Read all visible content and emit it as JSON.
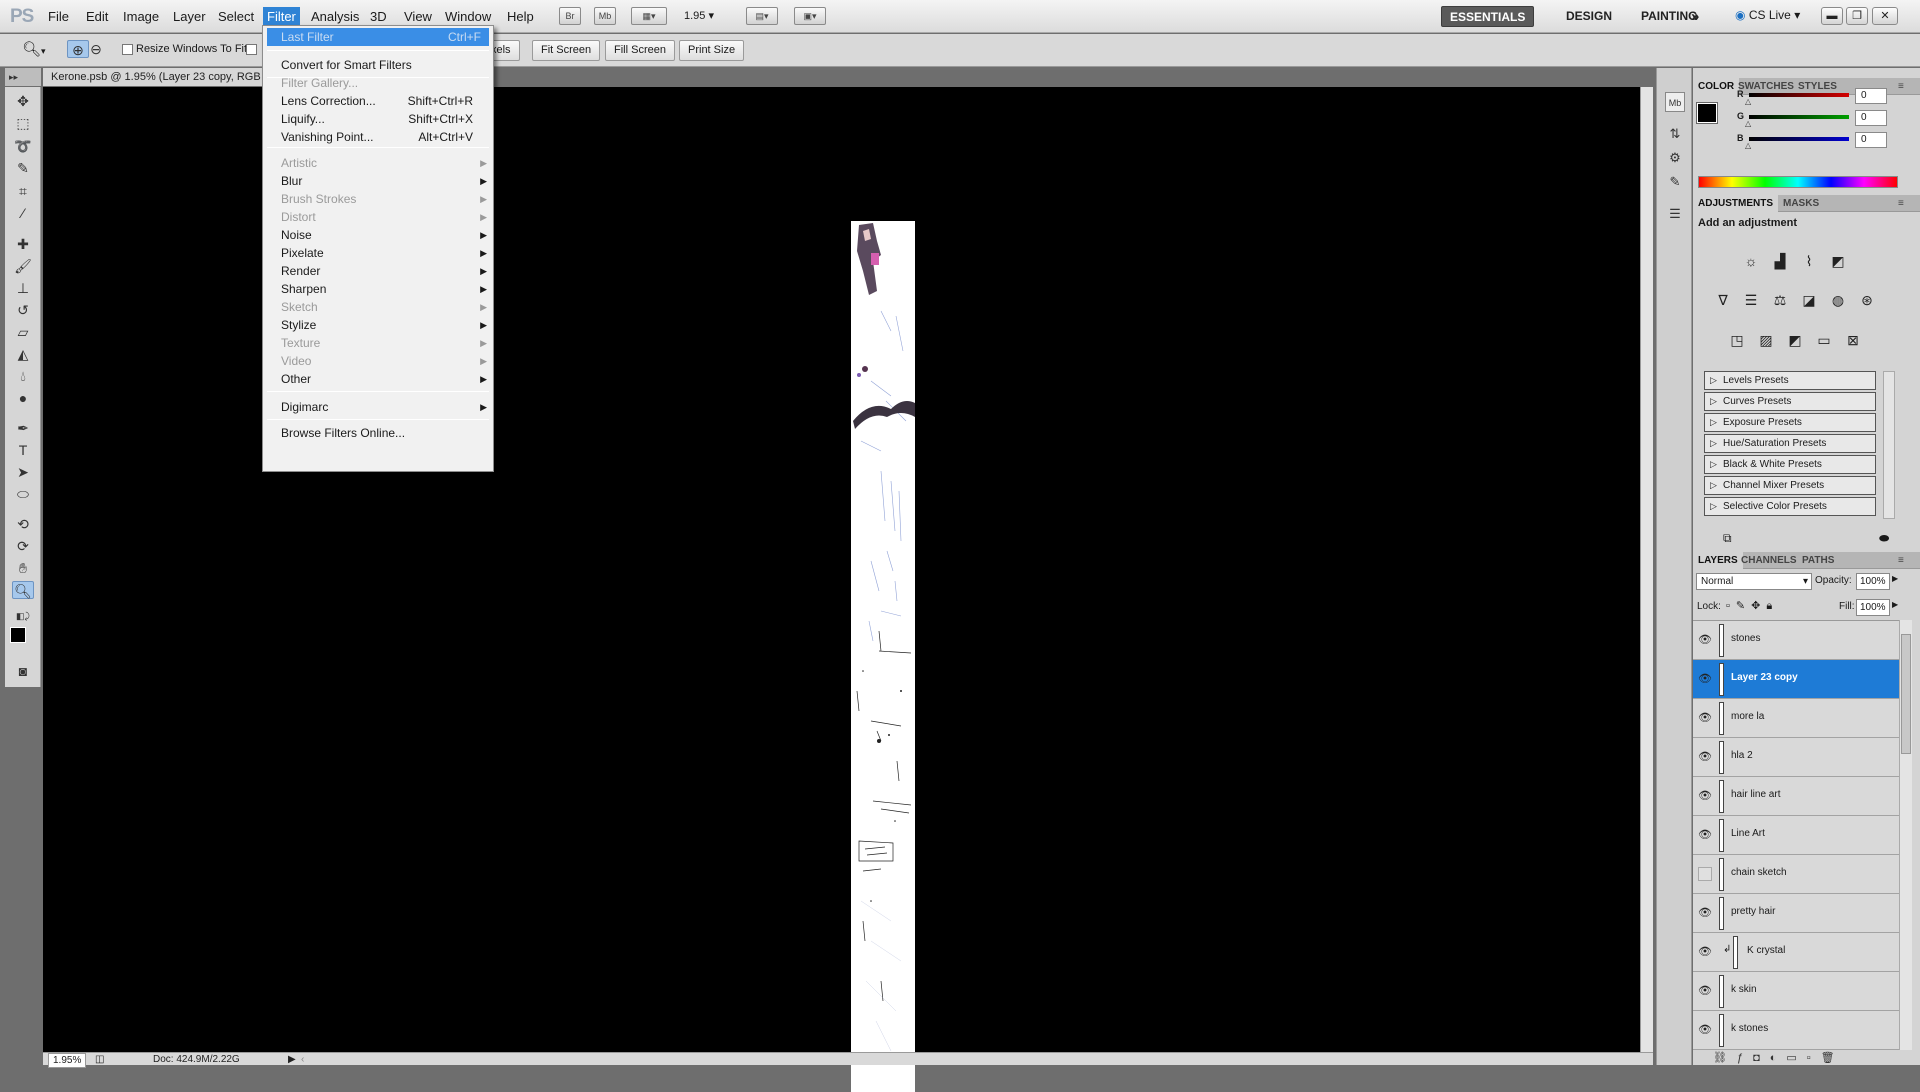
{
  "app": {
    "logo": "PS"
  },
  "menubar": {
    "items": [
      "File",
      "Edit",
      "Image",
      "Layer",
      "Select",
      "Filter",
      "Analysis",
      "3D",
      "View",
      "Window",
      "Help"
    ],
    "active": "Filter",
    "br_label": "Br",
    "mb_label": "Mb",
    "zoom_value": "1.95",
    "workspaces": [
      "ESSENTIALS",
      "DESIGN",
      "PAINTING"
    ],
    "cslive": "CS Live"
  },
  "options": {
    "resize_windows": "Resize Windows To Fit",
    "pixels_partial": "xels",
    "fit_screen": "Fit Screen",
    "fill_screen": "Fill Screen",
    "print_size": "Print Size"
  },
  "document": {
    "tab_title": "Kerone.psb @ 1.95% (Layer 23 copy, RGB",
    "status_zoom": "1.95%",
    "status_doc": "Doc: 424.9M/2.22G"
  },
  "filter_menu": {
    "items": [
      {
        "label": "Last Filter",
        "shortcut": "Ctrl+F",
        "disabled": true,
        "highlighted": true
      },
      {
        "label": "Convert for Smart Filters"
      },
      {
        "label": "Filter Gallery...",
        "disabled": true
      },
      {
        "label": "Lens Correction...",
        "shortcut": "Shift+Ctrl+R"
      },
      {
        "label": "Liquify...",
        "shortcut": "Shift+Ctrl+X"
      },
      {
        "label": "Vanishing Point...",
        "shortcut": "Alt+Ctrl+V"
      },
      {
        "label": "Artistic",
        "disabled": true,
        "submenu": true
      },
      {
        "label": "Blur",
        "submenu": true
      },
      {
        "label": "Brush Strokes",
        "disabled": true,
        "submenu": true
      },
      {
        "label": "Distort",
        "disabled": true,
        "submenu": true
      },
      {
        "label": "Noise",
        "submenu": true
      },
      {
        "label": "Pixelate",
        "submenu": true
      },
      {
        "label": "Render",
        "submenu": true
      },
      {
        "label": "Sharpen",
        "submenu": true
      },
      {
        "label": "Sketch",
        "disabled": true,
        "submenu": true
      },
      {
        "label": "Stylize",
        "submenu": true
      },
      {
        "label": "Texture",
        "disabled": true,
        "submenu": true
      },
      {
        "label": "Video",
        "disabled": true,
        "submenu": true
      },
      {
        "label": "Other",
        "submenu": true
      },
      {
        "label": "Digimarc",
        "submenu": true
      },
      {
        "label": "Browse Filters Online..."
      }
    ]
  },
  "color_panel": {
    "tabs": [
      "COLOR",
      "SWATCHES",
      "STYLES"
    ],
    "channels": [
      {
        "label": "R",
        "value": "0",
        "color": "#d40000"
      },
      {
        "label": "G",
        "value": "0",
        "color": "#00a000"
      },
      {
        "label": "B",
        "value": "0",
        "color": "#0000d0"
      }
    ]
  },
  "adjustments_panel": {
    "tabs": [
      "ADJUSTMENTS",
      "MASKS"
    ],
    "heading": "Add an adjustment",
    "presets": [
      "Levels Presets",
      "Curves Presets",
      "Exposure Presets",
      "Hue/Saturation Presets",
      "Black & White Presets",
      "Channel Mixer Presets",
      "Selective Color Presets"
    ]
  },
  "layers_panel": {
    "tabs": [
      "LAYERS",
      "CHANNELS",
      "PATHS"
    ],
    "blend_mode": "Normal",
    "opacity_label": "Opacity:",
    "opacity": "100%",
    "lock_label": "Lock:",
    "fill_label": "Fill:",
    "fill": "100%",
    "layers": [
      {
        "name": "stones",
        "visible": true
      },
      {
        "name": "Layer 23 copy",
        "visible": true,
        "selected": true
      },
      {
        "name": "more la",
        "visible": true
      },
      {
        "name": "hla 2",
        "visible": true
      },
      {
        "name": "hair line art",
        "visible": true
      },
      {
        "name": "Line Art",
        "visible": true
      },
      {
        "name": "chain sketch",
        "visible": false
      },
      {
        "name": "pretty hair",
        "visible": true
      },
      {
        "name": "K crystal",
        "visible": true,
        "clipped": true
      },
      {
        "name": "k skin",
        "visible": true
      },
      {
        "name": "k stones",
        "visible": true
      }
    ]
  }
}
